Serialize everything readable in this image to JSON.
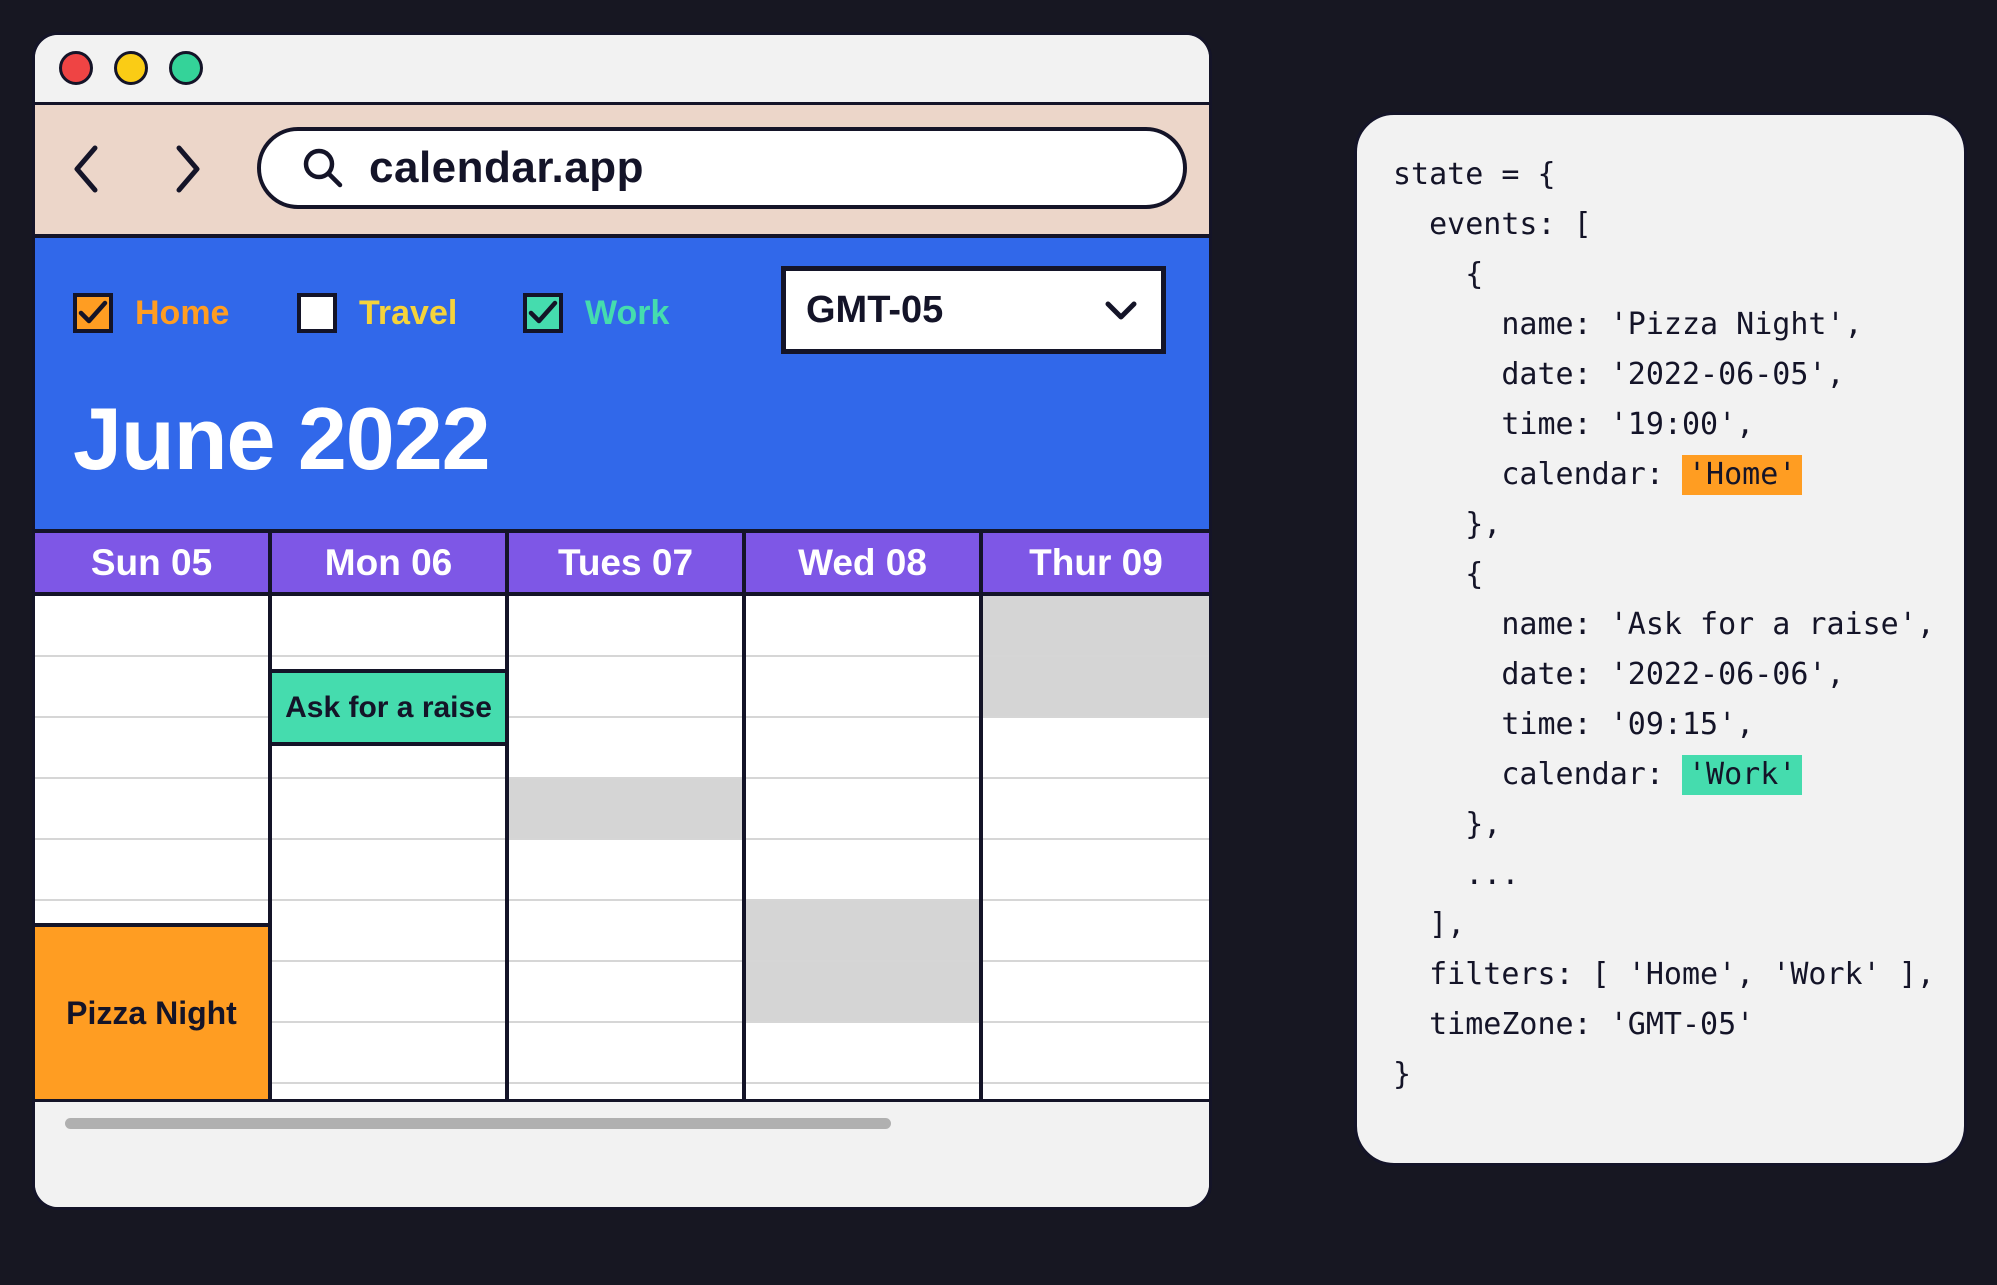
{
  "browser": {
    "url": "calendar.app"
  },
  "filters": [
    {
      "label": "Home",
      "checked": true,
      "color": "#ff9d22",
      "box_color": "#ff9d22"
    },
    {
      "label": "Travel",
      "checked": false,
      "color": "#f5d33b",
      "box_color": "#ffffff"
    },
    {
      "label": "Work",
      "checked": true,
      "color": "#45dcae",
      "box_color": "#45dcae"
    }
  ],
  "timezone": {
    "selected": "GMT-05"
  },
  "month_title": "June 2022",
  "days": [
    {
      "label": "Sun 05",
      "busy_slots": [],
      "event": {
        "name": "Pizza Night",
        "calendar": "home"
      }
    },
    {
      "label": "Mon 06",
      "busy_slots": [],
      "event": {
        "name": "Ask for a raise",
        "calendar": "work"
      }
    },
    {
      "label": "Tues 07",
      "busy_slots": [
        3
      ],
      "event": null
    },
    {
      "label": "Wed 08",
      "busy_slots": [
        5,
        6
      ],
      "event": null
    },
    {
      "label": "Thur 09",
      "busy_slots": [
        0,
        1
      ],
      "event": null
    }
  ],
  "code": {
    "l1": "state = {",
    "l2": "  events: [",
    "l3": "    {",
    "l4": "      name: 'Pizza Night',",
    "l5": "      date: '2022-06-05',",
    "l6": "      time: '19:00',",
    "l7_key": "      calendar: ",
    "l7_val": "'Home'",
    "l8": "    },",
    "l9": "    {",
    "l10": "      name: 'Ask for a raise',",
    "l11": "      date: '2022-06-06',",
    "l12": "      time: '09:15',",
    "l13_key": "      calendar: ",
    "l13_val": "'Work'",
    "l14": "    },",
    "l15": "    ...",
    "l16": "  ],",
    "l17": "  filters: [ 'Home', 'Work' ],",
    "l18": "  timeZone: 'GMT-05'",
    "l19": "}"
  },
  "colors": {
    "header_blue": "#3168ea",
    "day_header_purple": "#7e57e6",
    "home_orange": "#ff9d22",
    "work_green": "#45dcae",
    "busy_gray": "#d5d5d5",
    "ink": "#141428"
  }
}
